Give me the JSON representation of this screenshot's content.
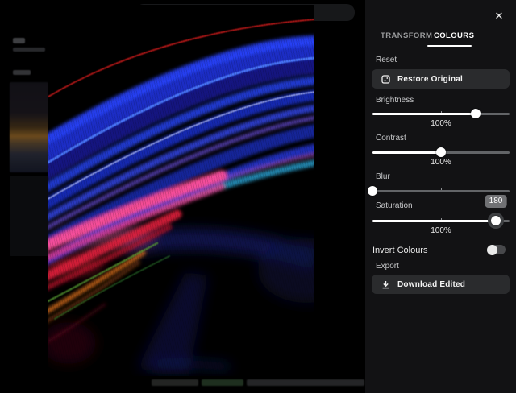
{
  "editor_panel": {
    "close_icon": "✕",
    "tabs": [
      {
        "label": "TRANSFORM",
        "active": false
      },
      {
        "label": "COLOURS",
        "active": true
      }
    ],
    "reset_section": {
      "label": "Reset",
      "button_label": "Restore Original",
      "button_icon": "restore-image-icon"
    },
    "sliders": [
      {
        "label": "Brightness",
        "value": "100%",
        "fill": "75%"
      },
      {
        "label": "Contrast",
        "value": "100%",
        "fill": "50%"
      },
      {
        "label": "Blur",
        "value": "",
        "fill": "0%"
      },
      {
        "label": "Saturation",
        "value": "100%",
        "fill": "90%",
        "tooltip": "180"
      }
    ],
    "invert_toggle": {
      "label": "Invert Colours",
      "state": "off"
    },
    "export_section": {
      "label": "Export",
      "button_label": "Download Edited",
      "button_icon": "download-icon"
    },
    "colors": {
      "panel_bg": "#121214",
      "button_bg": "#2a2b2d",
      "slider_fill": "#ffffff",
      "slider_track": "#626467",
      "tooltip_bg": "#707174",
      "tab_active": "#ffffff",
      "tab_inactive": "#9a9b9d"
    }
  },
  "backdrop": {
    "dimmed": true,
    "legible_text": []
  },
  "photo": {
    "subject": "long-exposure light trails: blue, violet, pink, red, orange streaks arcing over black"
  }
}
